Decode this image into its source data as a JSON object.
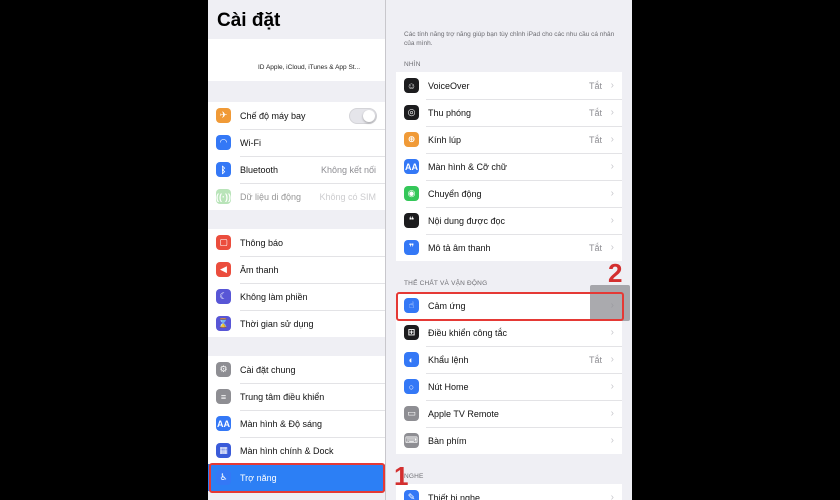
{
  "settings": {
    "title": "Cài đặt",
    "apple_id_text": "ID Apple, iCloud, iTunes & App St...",
    "group1": [
      {
        "name": "airplane",
        "label": "Chế độ máy bay",
        "icon": "airplane-icon",
        "color": "#f09a37",
        "glyph": "✈",
        "toggle": true
      },
      {
        "name": "wifi",
        "label": "Wi-Fi",
        "icon": "wifi-icon",
        "color": "#3478f6",
        "glyph": "◠"
      },
      {
        "name": "bluetooth",
        "label": "Bluetooth",
        "value": "Không kết nối",
        "icon": "bluetooth-icon",
        "color": "#3478f6",
        "glyph": "ᛒ"
      },
      {
        "name": "cellular",
        "label": "Dữ liệu di động",
        "value": "Không có SIM",
        "icon": "cellular-icon",
        "color": "#65c466",
        "glyph": "((·))",
        "dim": true
      }
    ],
    "group2": [
      {
        "name": "notifications",
        "label": "Thông báo",
        "icon": "notifications-icon",
        "color": "#eb4d3d",
        "glyph": "▢"
      },
      {
        "name": "sounds",
        "label": "Âm thanh",
        "icon": "sounds-icon",
        "color": "#eb4d3d",
        "glyph": "◀"
      },
      {
        "name": "do-not-disturb",
        "label": "Không làm phiền",
        "icon": "moon-icon",
        "color": "#5856d6",
        "glyph": "☾"
      },
      {
        "name": "screen-time",
        "label": "Thời gian sử dụng",
        "icon": "hourglass-icon",
        "color": "#5856d6",
        "glyph": "⌛"
      }
    ],
    "group3": [
      {
        "name": "general",
        "label": "Cài đặt chung",
        "icon": "gear-icon",
        "color": "#8e8e93",
        "glyph": "⚙"
      },
      {
        "name": "control-center",
        "label": "Trung tâm điều khiển",
        "icon": "toggles-icon",
        "color": "#8e8e93",
        "glyph": "≡"
      },
      {
        "name": "display",
        "label": "Màn hình & Độ sáng",
        "icon": "text-size-icon",
        "color": "#3478f6",
        "glyph": "AA"
      },
      {
        "name": "home-dock",
        "label": "Màn hình chính & Dock",
        "icon": "grid-icon",
        "color": "#3a5bd9",
        "glyph": "▦"
      },
      {
        "name": "accessibility",
        "label": "Trợ năng",
        "icon": "accessibility-icon",
        "color": "#3478f6",
        "glyph": "♿",
        "selected": true
      }
    ]
  },
  "accessibility": {
    "intro": "Các tính năng trợ năng giúp bạn tùy chỉnh iPad cho các nhu cầu cá nhân của mình.",
    "section_vision": "NHÌN",
    "section_physical": "THỂ CHẤT VÀ VẬN ĐỘNG",
    "section_hearing": "NGHE",
    "vision": [
      {
        "name": "voiceover",
        "label": "VoiceOver",
        "value": "Tắt",
        "icon": "voiceover-icon",
        "color": "#1c1c1e",
        "glyph": "☺"
      },
      {
        "name": "zoom",
        "label": "Thu phóng",
        "value": "Tắt",
        "icon": "zoom-icon",
        "color": "#1c1c1e",
        "glyph": "◎"
      },
      {
        "name": "magnifier",
        "label": "Kính lúp",
        "value": "Tắt",
        "icon": "magnifier-icon",
        "color": "#f09a37",
        "glyph": "⊕"
      },
      {
        "name": "display-text",
        "label": "Màn hình & Cỡ chữ",
        "value": "",
        "icon": "text-size-icon",
        "color": "#3478f6",
        "glyph": "AA"
      },
      {
        "name": "motion",
        "label": "Chuyển động",
        "value": "",
        "icon": "motion-icon",
        "color": "#34c759",
        "glyph": "◉"
      },
      {
        "name": "spoken-content",
        "label": "Nội dung được đọc",
        "value": "",
        "icon": "speech-icon",
        "color": "#1c1c1e",
        "glyph": "❝"
      },
      {
        "name": "audio-descriptions",
        "label": "Mô tả âm thanh",
        "value": "Tắt",
        "icon": "audio-description-icon",
        "color": "#3478f6",
        "glyph": "❞"
      }
    ],
    "physical": [
      {
        "name": "touch",
        "label": "Cảm ứng",
        "value": "",
        "icon": "hand-icon",
        "color": "#3478f6",
        "glyph": "☝"
      },
      {
        "name": "switch-control",
        "label": "Điều khiển công tắc",
        "value": "",
        "icon": "switch-icon",
        "color": "#1c1c1e",
        "glyph": "⊞"
      },
      {
        "name": "voice-control",
        "label": "Khẩu lệnh",
        "value": "Tắt",
        "icon": "voice-control-icon",
        "color": "#3478f6",
        "glyph": "◐"
      },
      {
        "name": "home-button",
        "label": "Nút Home",
        "value": "",
        "icon": "home-button-icon",
        "color": "#3478f6",
        "glyph": "○"
      },
      {
        "name": "apple-tv-remote",
        "label": "Apple TV Remote",
        "value": "",
        "icon": "remote-icon",
        "color": "#8e8e93",
        "glyph": "▭"
      },
      {
        "name": "keyboards",
        "label": "Bàn phím",
        "value": "",
        "icon": "keyboard-icon",
        "color": "#8e8e93",
        "glyph": "⌨"
      }
    ],
    "hearing": [
      {
        "name": "hearing-devices",
        "label": "Thiết bị nghe",
        "value": "",
        "icon": "ear-icon",
        "color": "#3478f6",
        "glyph": "✎"
      }
    ],
    "chevron": "›"
  },
  "annotations": {
    "step1": "1",
    "step2": "2"
  }
}
